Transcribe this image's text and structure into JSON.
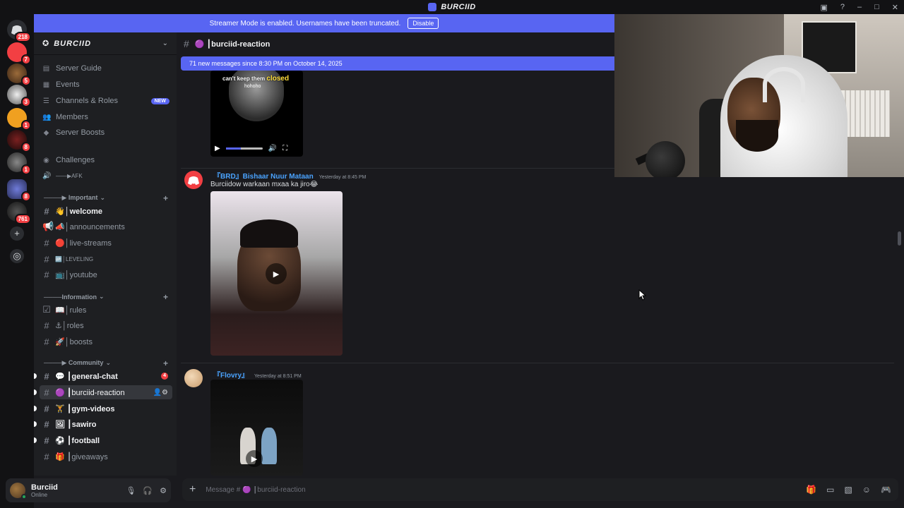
{
  "titlebar": {
    "app_title": "BURCIID"
  },
  "streamer_banner": {
    "message": "Streamer Mode is enabled. Usernames have been truncated.",
    "disable_label": "Disable"
  },
  "guilds": [
    {
      "badge": "218"
    },
    {
      "badge": "7"
    },
    {
      "badge": "5"
    },
    {
      "badge": "3"
    },
    {
      "badge": "1"
    },
    {
      "badge": "8"
    },
    {
      "badge": "1"
    },
    {
      "badge": "8"
    },
    {
      "badge": "761"
    }
  ],
  "server": {
    "name": "BURCIID"
  },
  "nav": {
    "server_guide": "Server Guide",
    "events": "Events",
    "channels_roles": "Channels & Roles",
    "new_badge": "NEW",
    "members": "Members",
    "server_boosts": "Server Boosts",
    "challenges": "Challenges",
    "afk": "——▶AFK"
  },
  "categories": {
    "important": "────▶ Important",
    "information": "────Information",
    "community": "────▶ Community"
  },
  "channels": {
    "welcome": "👋│welcome",
    "announcements": "📣│announcements",
    "live_streams": "🔴│live-streams",
    "leveling": "🆙│LEVELING",
    "youtube": "📺│youtube",
    "rules": "📖│rules",
    "roles": "⚓│roles",
    "boosts": "🚀│boosts",
    "general_chat": "💬 ┃general-chat",
    "general_chat_mentions": "4",
    "burciid_reaction": "🟣 ┃burciid-reaction",
    "gym_videos": "🏋 ┃gym-videos",
    "sawiro": "🖼 ┃sawiro",
    "football": "⚽ ┃football",
    "giveaways": "🎁 ┃giveaways"
  },
  "user": {
    "name": "Burciid",
    "status": "Online"
  },
  "channel_header": {
    "name": "🟣 ┃burciid-reaction"
  },
  "new_messages_bar": "71 new messages since 8:30 PM on October 14, 2025",
  "video1": {
    "caption_top": "can't keep them",
    "caption_highlight": "closed",
    "caption_sub": "hohoho"
  },
  "messages": [
    {
      "author": "『BRD』Bishaar Nuur Mataan",
      "timestamp": "Yesterday at 8:45 PM",
      "text": "Burciidow warkaan mxaa ka jiro😂"
    },
    {
      "author": "『Flovry』",
      "timestamp": "Yesterday at 8:51 PM",
      "text": ""
    }
  ],
  "composer": {
    "placeholder": "Message # 🟣 ┃burciid-reaction"
  },
  "colors": {
    "accent": "#5865f2",
    "mention": "#f23f43",
    "online": "#23a55a",
    "author": "#4aa3ff"
  }
}
